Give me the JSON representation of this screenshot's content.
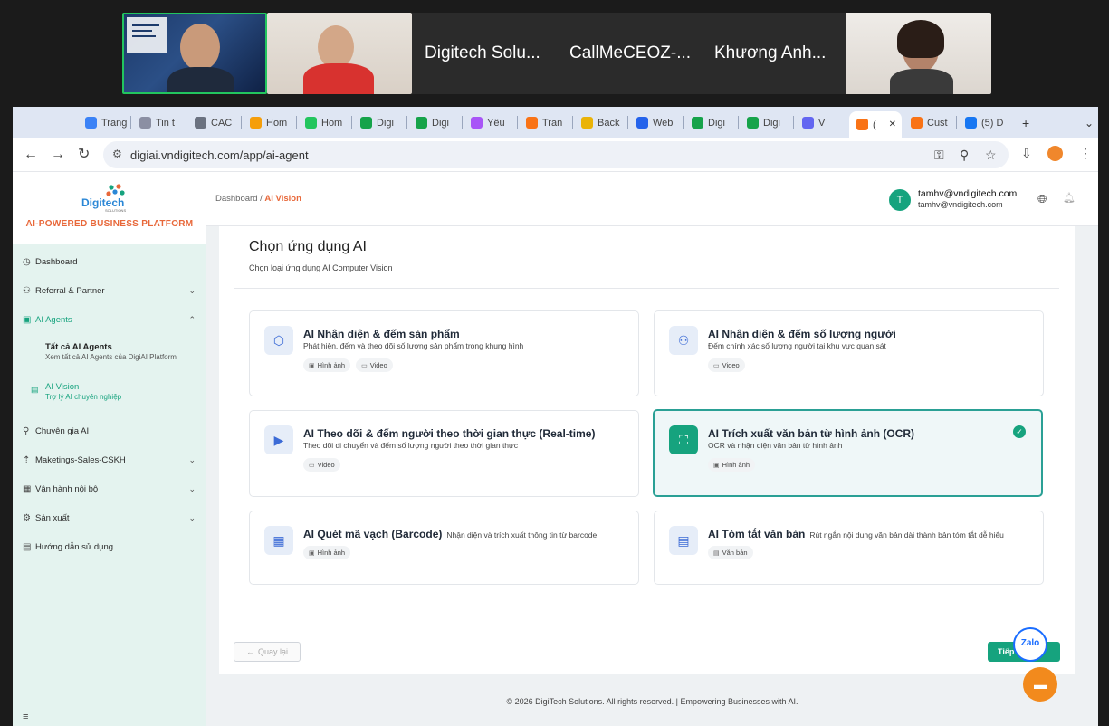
{
  "call": {
    "participants": [
      "Digitech Solu...",
      "CallMeCEOZ-...",
      "Khương Anh..."
    ]
  },
  "browser": {
    "tabs": [
      {
        "label": "Trang",
        "color": "#3b82f6"
      },
      {
        "label": "Tin t",
        "color": "#8b8fa3"
      },
      {
        "label": "CAC",
        "color": "#6b7280"
      },
      {
        "label": "Hom",
        "color": "#f59e0b"
      },
      {
        "label": "Hom",
        "color": "#22c55e"
      },
      {
        "label": "Digi",
        "color": "#16a34a"
      },
      {
        "label": "Digi",
        "color": "#16a34a"
      },
      {
        "label": "Yêu",
        "color": "#a855f7"
      },
      {
        "label": "Tran",
        "color": "#f97316"
      },
      {
        "label": "Back",
        "color": "#eab308"
      },
      {
        "label": "Web",
        "color": "#2563eb"
      },
      {
        "label": "Digi",
        "color": "#16a34a"
      },
      {
        "label": "Digi",
        "color": "#16a34a"
      },
      {
        "label": "V",
        "color": "#6366f1"
      },
      {
        "label": "(",
        "color": "#f97316"
      },
      {
        "label": "Cust",
        "color": "#f97316"
      },
      {
        "label": "(5) D",
        "color": "#1877f2"
      }
    ],
    "url": "digiai.vndigitech.com/app/ai-agent"
  },
  "sidebar": {
    "brand": "Digitech",
    "brand_sub": "SOLUTIONS",
    "platform": "AI-POWERED BUSINESS PLATFORM",
    "items": [
      {
        "label": "Dashboard",
        "icon": "dashboard-icon",
        "glyph": "◷"
      },
      {
        "label": "Referral & Partner",
        "icon": "referral-icon",
        "glyph": "⚇"
      },
      {
        "label": "AI Agents",
        "icon": "agents-icon",
        "glyph": "▣"
      },
      {
        "label": "Chuyên gia AI",
        "icon": "expert-icon",
        "glyph": "⚲"
      },
      {
        "label": "Maketings-Sales-CSKH",
        "icon": "marketing-icon",
        "glyph": "⇡"
      },
      {
        "label": "Vận hành nội bộ",
        "icon": "operations-icon",
        "glyph": "▦"
      },
      {
        "label": "Sản xuất",
        "icon": "production-icon",
        "glyph": "⚙"
      },
      {
        "label": "Hướng dẫn sử dụng",
        "icon": "guide-icon",
        "glyph": "▤"
      }
    ],
    "sub_items": [
      {
        "title": "Tất cả AI Agents",
        "desc": "Xem tất cả AI Agents của DigiAI Platform"
      },
      {
        "title": "AI Vision",
        "desc": "Trợ lý AI chuyên nghiệp"
      }
    ]
  },
  "header": {
    "crumb_root": "Dashboard",
    "crumb_sep": "/",
    "crumb_current": "AI Vision",
    "user_initial": "T",
    "user_name": "tamhv@vndigitech.com",
    "user_email": "tamhv@vndigitech.com"
  },
  "panel": {
    "title": "Chọn ứng dụng AI",
    "subtitle": "Chọn loại ứng dụng AI Computer Vision",
    "cards": [
      {
        "title": "AI Nhận diện & đếm sản phẩm",
        "desc": "Phát hiện, đếm và theo dõi số lượng sản phẩm trong khung hình",
        "chips": [
          "Hình ảnh",
          "Video"
        ],
        "icon": "box-icon",
        "selected": false
      },
      {
        "title": "AI Nhận diện & đếm số lượng người",
        "desc": "Đếm chính xác số lượng người tại khu vực quan sát",
        "chips": [
          "Video"
        ],
        "icon": "people-icon",
        "selected": false
      },
      {
        "title": "AI Theo dõi & đếm người theo thời gian thực (Real-time)",
        "desc": "Theo dõi di chuyển và đếm số lượng người theo thời gian thực",
        "chips": [
          "Video"
        ],
        "icon": "camera-icon",
        "selected": false
      },
      {
        "title": "AI Trích xuất văn bản từ hình ảnh (OCR)",
        "desc": "OCR và nhận diện văn bản từ hình ảnh",
        "chips": [
          "Hình ảnh"
        ],
        "icon": "scan-icon",
        "selected": true
      },
      {
        "title": "AI Quét mã vạch (Barcode)",
        "desc": "Nhận diện và trích xuất thông tin từ barcode",
        "chips": [
          "Hình ảnh"
        ],
        "icon": "qr-icon",
        "selected": false,
        "inline": true
      },
      {
        "title": "AI Tóm tắt văn bản",
        "desc": "Rút ngắn nội dung văn bản dài thành bản tóm tắt dễ hiểu",
        "chips": [
          "Văn bản"
        ],
        "icon": "document-icon",
        "selected": false,
        "inline": true
      }
    ],
    "back_label": "Quay lại",
    "next_label": "Tiếp th"
  },
  "footer": "© 2026 DigiTech Solutions. All rights reserved. | Empowering Businesses with AI.",
  "widgets": {
    "zalo": "Zalo"
  },
  "colors": {
    "accent": "#16a37e",
    "brand_orange": "#e8683a",
    "selected_border": "#2aa095"
  }
}
